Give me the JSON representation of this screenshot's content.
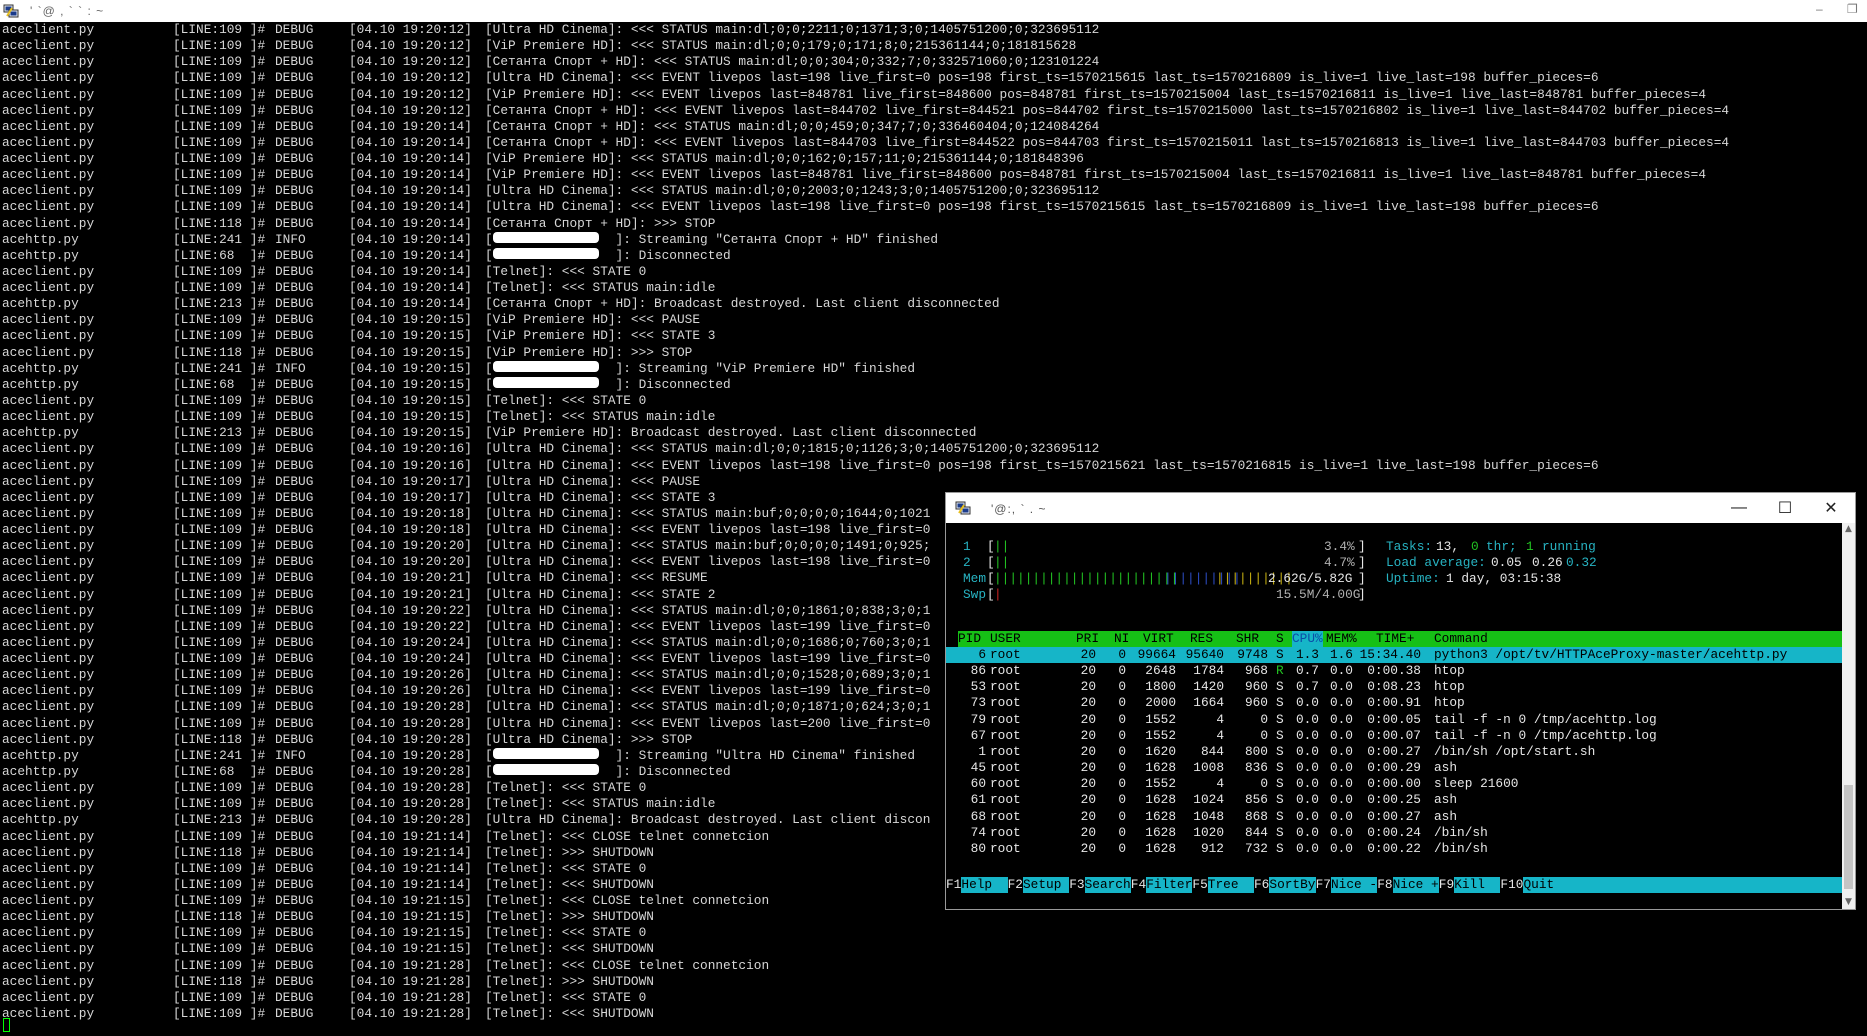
{
  "main_window": {
    "title": "' `@ , ` ` : ~",
    "controls": {
      "minimize": "–",
      "restore": "❐"
    }
  },
  "log_lines": [
    {
      "file": "aceclient.py",
      "line": "[LINE:109 ]#",
      "level": "DEBUG",
      "time": "[04.10 19:20:12]",
      "msg": "[Ultra HD Cinema]: <<< STATUS main:dl;0;0;2211;0;1371;3;0;1405751200;0;323695112"
    },
    {
      "file": "aceclient.py",
      "line": "[LINE:109 ]#",
      "level": "DEBUG",
      "time": "[04.10 19:20:12]",
      "msg": "[ViP Premiere HD]: <<< STATUS main:dl;0;0;179;0;171;8;0;215361144;0;181815628"
    },
    {
      "file": "aceclient.py",
      "line": "[LINE:109 ]#",
      "level": "DEBUG",
      "time": "[04.10 19:20:12]",
      "msg": "[Сетанта Спорт + HD]: <<< STATUS main:dl;0;0;304;0;332;7;0;332571060;0;123101224"
    },
    {
      "file": "aceclient.py",
      "line": "[LINE:109 ]#",
      "level": "DEBUG",
      "time": "[04.10 19:20:12]",
      "msg": "[Ultra HD Cinema]: <<< EVENT livepos last=198 live_first=0 pos=198 first_ts=1570215615 last_ts=1570216809 is_live=1 live_last=198 buffer_pieces=6"
    },
    {
      "file": "aceclient.py",
      "line": "[LINE:109 ]#",
      "level": "DEBUG",
      "time": "[04.10 19:20:12]",
      "msg": "[ViP Premiere HD]: <<< EVENT livepos last=848781 live_first=848600 pos=848781 first_ts=1570215004 last_ts=1570216811 is_live=1 live_last=848781 buffer_pieces=4"
    },
    {
      "file": "aceclient.py",
      "line": "[LINE:109 ]#",
      "level": "DEBUG",
      "time": "[04.10 19:20:12]",
      "msg": "[Сетанта Спорт + HD]: <<< EVENT livepos last=844702 live_first=844521 pos=844702 first_ts=1570215000 last_ts=1570216802 is_live=1 live_last=844702 buffer_pieces=4"
    },
    {
      "file": "aceclient.py",
      "line": "[LINE:109 ]#",
      "level": "DEBUG",
      "time": "[04.10 19:20:14]",
      "msg": "[Сетанта Спорт + HD]: <<< STATUS main:dl;0;0;459;0;347;7;0;336460404;0;124084264"
    },
    {
      "file": "aceclient.py",
      "line": "[LINE:109 ]#",
      "level": "DEBUG",
      "time": "[04.10 19:20:14]",
      "msg": "[Сетанта Спорт + HD]: <<< EVENT livepos last=844703 live_first=844522 pos=844703 first_ts=1570215011 last_ts=1570216813 is_live=1 live_last=844703 buffer_pieces=4"
    },
    {
      "file": "aceclient.py",
      "line": "[LINE:109 ]#",
      "level": "DEBUG",
      "time": "[04.10 19:20:14]",
      "msg": "[ViP Premiere HD]: <<< STATUS main:dl;0;0;162;0;157;11;0;215361144;0;181848396"
    },
    {
      "file": "aceclient.py",
      "line": "[LINE:109 ]#",
      "level": "DEBUG",
      "time": "[04.10 19:20:14]",
      "msg": "[ViP Premiere HD]: <<< EVENT livepos last=848781 live_first=848600 pos=848781 first_ts=1570215004 last_ts=1570216811 is_live=1 live_last=848781 buffer_pieces=4"
    },
    {
      "file": "aceclient.py",
      "line": "[LINE:109 ]#",
      "level": "DEBUG",
      "time": "[04.10 19:20:14]",
      "msg": "[Ultra HD Cinema]: <<< STATUS main:dl;0;0;2003;0;1243;3;0;1405751200;0;323695112"
    },
    {
      "file": "aceclient.py",
      "line": "[LINE:109 ]#",
      "level": "DEBUG",
      "time": "[04.10 19:20:14]",
      "msg": "[Ultra HD Cinema]: <<< EVENT livepos last=198 live_first=0 pos=198 first_ts=1570215615 last_ts=1570216809 is_live=1 live_last=198 buffer_pieces=6"
    },
    {
      "file": "aceclient.py",
      "line": "[LINE:118 ]#",
      "level": "DEBUG",
      "time": "[04.10 19:20:14]",
      "msg": "[Сетанта Спорт + HD]: >>> STOP"
    },
    {
      "file": "acehttp.py",
      "line": "[LINE:241 ]#",
      "level": "INFO",
      "time": "[04.10 19:20:14]",
      "msg": "[                ]: Streaming \"Сетанта Спорт + HD\" finished",
      "redact": true
    },
    {
      "file": "acehttp.py",
      "line": "[LINE:68  ]#",
      "level": "DEBUG",
      "time": "[04.10 19:20:14]",
      "msg": "[                ]: Disconnected",
      "redact": true
    },
    {
      "file": "aceclient.py",
      "line": "[LINE:109 ]#",
      "level": "DEBUG",
      "time": "[04.10 19:20:14]",
      "msg": "[Telnet]: <<< STATE 0"
    },
    {
      "file": "aceclient.py",
      "line": "[LINE:109 ]#",
      "level": "DEBUG",
      "time": "[04.10 19:20:14]",
      "msg": "[Telnet]: <<< STATUS main:idle"
    },
    {
      "file": "acehttp.py",
      "line": "[LINE:213 ]#",
      "level": "DEBUG",
      "time": "[04.10 19:20:14]",
      "msg": "[Сетанта Спорт + HD]: Broadcast destroyed. Last client disconnected"
    },
    {
      "file": "aceclient.py",
      "line": "[LINE:109 ]#",
      "level": "DEBUG",
      "time": "[04.10 19:20:15]",
      "msg": "[ViP Premiere HD]: <<< PAUSE"
    },
    {
      "file": "aceclient.py",
      "line": "[LINE:109 ]#",
      "level": "DEBUG",
      "time": "[04.10 19:20:15]",
      "msg": "[ViP Premiere HD]: <<< STATE 3"
    },
    {
      "file": "aceclient.py",
      "line": "[LINE:118 ]#",
      "level": "DEBUG",
      "time": "[04.10 19:20:15]",
      "msg": "[ViP Premiere HD]: >>> STOP"
    },
    {
      "file": "acehttp.py",
      "line": "[LINE:241 ]#",
      "level": "INFO",
      "time": "[04.10 19:20:15]",
      "msg": "[                ]: Streaming \"ViP Premiere HD\" finished",
      "redact": true
    },
    {
      "file": "acehttp.py",
      "line": "[LINE:68  ]#",
      "level": "DEBUG",
      "time": "[04.10 19:20:15]",
      "msg": "[                ]: Disconnected",
      "redact": true
    },
    {
      "file": "aceclient.py",
      "line": "[LINE:109 ]#",
      "level": "DEBUG",
      "time": "[04.10 19:20:15]",
      "msg": "[Telnet]: <<< STATE 0"
    },
    {
      "file": "aceclient.py",
      "line": "[LINE:109 ]#",
      "level": "DEBUG",
      "time": "[04.10 19:20:15]",
      "msg": "[Telnet]: <<< STATUS main:idle"
    },
    {
      "file": "acehttp.py",
      "line": "[LINE:213 ]#",
      "level": "DEBUG",
      "time": "[04.10 19:20:15]",
      "msg": "[ViP Premiere HD]: Broadcast destroyed. Last client disconnected"
    },
    {
      "file": "aceclient.py",
      "line": "[LINE:109 ]#",
      "level": "DEBUG",
      "time": "[04.10 19:20:16]",
      "msg": "[Ultra HD Cinema]: <<< STATUS main:dl;0;0;1815;0;1126;3;0;1405751200;0;323695112"
    },
    {
      "file": "aceclient.py",
      "line": "[LINE:109 ]#",
      "level": "DEBUG",
      "time": "[04.10 19:20:16]",
      "msg": "[Ultra HD Cinema]: <<< EVENT livepos last=198 live_first=0 pos=198 first_ts=1570215621 last_ts=1570216815 is_live=1 live_last=198 buffer_pieces=6"
    },
    {
      "file": "aceclient.py",
      "line": "[LINE:109 ]#",
      "level": "DEBUG",
      "time": "[04.10 19:20:17]",
      "msg": "[Ultra HD Cinema]: <<< PAUSE"
    },
    {
      "file": "aceclient.py",
      "line": "[LINE:109 ]#",
      "level": "DEBUG",
      "time": "[04.10 19:20:17]",
      "msg": "[Ultra HD Cinema]: <<< STATE 3"
    },
    {
      "file": "aceclient.py",
      "line": "[LINE:109 ]#",
      "level": "DEBUG",
      "time": "[04.10 19:20:18]",
      "msg": "[Ultra HD Cinema]: <<< STATUS main:buf;0;0;0;0;1644;0;1021"
    },
    {
      "file": "aceclient.py",
      "line": "[LINE:109 ]#",
      "level": "DEBUG",
      "time": "[04.10 19:20:18]",
      "msg": "[Ultra HD Cinema]: <<< EVENT livepos last=198 live_first=0"
    },
    {
      "file": "aceclient.py",
      "line": "[LINE:109 ]#",
      "level": "DEBUG",
      "time": "[04.10 19:20:20]",
      "msg": "[Ultra HD Cinema]: <<< STATUS main:buf;0;0;0;0;1491;0;925;"
    },
    {
      "file": "aceclient.py",
      "line": "[LINE:109 ]#",
      "level": "DEBUG",
      "time": "[04.10 19:20:20]",
      "msg": "[Ultra HD Cinema]: <<< EVENT livepos last=198 live_first=0"
    },
    {
      "file": "aceclient.py",
      "line": "[LINE:109 ]#",
      "level": "DEBUG",
      "time": "[04.10 19:20:21]",
      "msg": "[Ultra HD Cinema]: <<< RESUME"
    },
    {
      "file": "aceclient.py",
      "line": "[LINE:109 ]#",
      "level": "DEBUG",
      "time": "[04.10 19:20:21]",
      "msg": "[Ultra HD Cinema]: <<< STATE 2"
    },
    {
      "file": "aceclient.py",
      "line": "[LINE:109 ]#",
      "level": "DEBUG",
      "time": "[04.10 19:20:22]",
      "msg": "[Ultra HD Cinema]: <<< STATUS main:dl;0;0;1861;0;838;3;0;1"
    },
    {
      "file": "aceclient.py",
      "line": "[LINE:109 ]#",
      "level": "DEBUG",
      "time": "[04.10 19:20:22]",
      "msg": "[Ultra HD Cinema]: <<< EVENT livepos last=199 live_first=0"
    },
    {
      "file": "aceclient.py",
      "line": "[LINE:109 ]#",
      "level": "DEBUG",
      "time": "[04.10 19:20:24]",
      "msg": "[Ultra HD Cinema]: <<< STATUS main:dl;0;0;1686;0;760;3;0;1"
    },
    {
      "file": "aceclient.py",
      "line": "[LINE:109 ]#",
      "level": "DEBUG",
      "time": "[04.10 19:20:24]",
      "msg": "[Ultra HD Cinema]: <<< EVENT livepos last=199 live_first=0"
    },
    {
      "file": "aceclient.py",
      "line": "[LINE:109 ]#",
      "level": "DEBUG",
      "time": "[04.10 19:20:26]",
      "msg": "[Ultra HD Cinema]: <<< STATUS main:dl;0;0;1528;0;689;3;0;1"
    },
    {
      "file": "aceclient.py",
      "line": "[LINE:109 ]#",
      "level": "DEBUG",
      "time": "[04.10 19:20:26]",
      "msg": "[Ultra HD Cinema]: <<< EVENT livepos last=199 live_first=0"
    },
    {
      "file": "aceclient.py",
      "line": "[LINE:109 ]#",
      "level": "DEBUG",
      "time": "[04.10 19:20:28]",
      "msg": "[Ultra HD Cinema]: <<< STATUS main:dl;0;0;1871;0;624;3;0;1"
    },
    {
      "file": "aceclient.py",
      "line": "[LINE:109 ]#",
      "level": "DEBUG",
      "time": "[04.10 19:20:28]",
      "msg": "[Ultra HD Cinema]: <<< EVENT livepos last=200 live_first=0"
    },
    {
      "file": "aceclient.py",
      "line": "[LINE:118 ]#",
      "level": "DEBUG",
      "time": "[04.10 19:20:28]",
      "msg": "[Ultra HD Cinema]: >>> STOP"
    },
    {
      "file": "acehttp.py",
      "line": "[LINE:241 ]#",
      "level": "INFO",
      "time": "[04.10 19:20:28]",
      "msg": "[                ]: Streaming \"Ultra HD Cinema\" finished",
      "redact": true
    },
    {
      "file": "acehttp.py",
      "line": "[LINE:68  ]#",
      "level": "DEBUG",
      "time": "[04.10 19:20:28]",
      "msg": "[                ]: Disconnected",
      "redact": true
    },
    {
      "file": "aceclient.py",
      "line": "[LINE:109 ]#",
      "level": "DEBUG",
      "time": "[04.10 19:20:28]",
      "msg": "[Telnet]: <<< STATE 0"
    },
    {
      "file": "aceclient.py",
      "line": "[LINE:109 ]#",
      "level": "DEBUG",
      "time": "[04.10 19:20:28]",
      "msg": "[Telnet]: <<< STATUS main:idle"
    },
    {
      "file": "acehttp.py",
      "line": "[LINE:213 ]#",
      "level": "DEBUG",
      "time": "[04.10 19:20:28]",
      "msg": "[Ultra HD Cinema]: Broadcast destroyed. Last client discon"
    },
    {
      "file": "aceclient.py",
      "line": "[LINE:109 ]#",
      "level": "DEBUG",
      "time": "[04.10 19:21:14]",
      "msg": "[Telnet]: <<< CLOSE telnet connetcion"
    },
    {
      "file": "aceclient.py",
      "line": "[LINE:118 ]#",
      "level": "DEBUG",
      "time": "[04.10 19:21:14]",
      "msg": "[Telnet]: >>> SHUTDOWN"
    },
    {
      "file": "aceclient.py",
      "line": "[LINE:109 ]#",
      "level": "DEBUG",
      "time": "[04.10 19:21:14]",
      "msg": "[Telnet]: <<< STATE 0"
    },
    {
      "file": "aceclient.py",
      "line": "[LINE:109 ]#",
      "level": "DEBUG",
      "time": "[04.10 19:21:14]",
      "msg": "[Telnet]: <<< SHUTDOWN"
    },
    {
      "file": "aceclient.py",
      "line": "[LINE:109 ]#",
      "level": "DEBUG",
      "time": "[04.10 19:21:15]",
      "msg": "[Telnet]: <<< CLOSE telnet connetcion"
    },
    {
      "file": "aceclient.py",
      "line": "[LINE:118 ]#",
      "level": "DEBUG",
      "time": "[04.10 19:21:15]",
      "msg": "[Telnet]: >>> SHUTDOWN"
    },
    {
      "file": "aceclient.py",
      "line": "[LINE:109 ]#",
      "level": "DEBUG",
      "time": "[04.10 19:21:15]",
      "msg": "[Telnet]: <<< STATE 0"
    },
    {
      "file": "aceclient.py",
      "line": "[LINE:109 ]#",
      "level": "DEBUG",
      "time": "[04.10 19:21:15]",
      "msg": "[Telnet]: <<< SHUTDOWN"
    },
    {
      "file": "aceclient.py",
      "line": "[LINE:109 ]#",
      "level": "DEBUG",
      "time": "[04.10 19:21:28]",
      "msg": "[Telnet]: <<< CLOSE telnet connetcion"
    },
    {
      "file": "aceclient.py",
      "line": "[LINE:118 ]#",
      "level": "DEBUG",
      "time": "[04.10 19:21:28]",
      "msg": "[Telnet]: >>> SHUTDOWN"
    },
    {
      "file": "aceclient.py",
      "line": "[LINE:109 ]#",
      "level": "DEBUG",
      "time": "[04.10 19:21:28]",
      "msg": "[Telnet]: <<< STATE 0"
    },
    {
      "file": "aceclient.py",
      "line": "[LINE:109 ]#",
      "level": "DEBUG",
      "time": "[04.10 19:21:28]",
      "msg": "[Telnet]: <<< SHUTDOWN"
    }
  ],
  "htop_window": {
    "title": "'@:, ` . ~",
    "controls": {
      "minimize": "—",
      "maximize": "☐",
      "close": "✕"
    },
    "meters": {
      "cpu1": {
        "label": "1",
        "bar": "||",
        "value": "3.4%"
      },
      "cpu2": {
        "label": "2",
        "bar": "||",
        "value": "4.7%"
      },
      "mem": {
        "label": "Mem",
        "bar_green": "||||||||||||||||||||||||",
        "bar_blue": "||||||||||",
        "bar_yellow": "||||||||||",
        "value": "2.62G/5.82G"
      },
      "swp": {
        "label": "Swp",
        "bar_red": "|",
        "value": "15.5M/4.00G"
      },
      "tasks_label": "Tasks:",
      "tasks": "13,",
      "thr": "0",
      "thr_label": "thr;",
      "running": "1",
      "running_label": "running",
      "load_label": "Load average:",
      "load1": "0.05",
      "load5": "0.26",
      "load15": "0.32",
      "uptime_label": "Uptime:",
      "uptime": "1 day, 03:15:38"
    },
    "columns": [
      "PID",
      "USER",
      "PRI",
      "NI",
      "VIRT",
      "RES",
      "SHR",
      "S",
      "CPU%",
      "MEM%",
      "TIME+",
      "Command"
    ],
    "processes": [
      {
        "pid": "6",
        "user": "root",
        "pri": "20",
        "ni": "0",
        "virt": "99664",
        "res": "95640",
        "shr": "9748",
        "s": "S",
        "cpu": "1.3",
        "mem": "1.6",
        "time": "15:34.40",
        "cmd": "python3 /opt/tv/HTTPAceProxy-master/acehttp.py"
      },
      {
        "pid": "86",
        "user": "root",
        "pri": "20",
        "ni": "0",
        "virt": "2648",
        "res": "1784",
        "shr": "968",
        "s": "R",
        "cpu": "0.7",
        "mem": "0.0",
        "time": "0:00.38",
        "cmd": "htop"
      },
      {
        "pid": "53",
        "user": "root",
        "pri": "20",
        "ni": "0",
        "virt": "1800",
        "res": "1420",
        "shr": "960",
        "s": "S",
        "cpu": "0.7",
        "mem": "0.0",
        "time": "0:08.23",
        "cmd": "htop"
      },
      {
        "pid": "73",
        "user": "root",
        "pri": "20",
        "ni": "0",
        "virt": "2000",
        "res": "1664",
        "shr": "960",
        "s": "S",
        "cpu": "0.0",
        "mem": "0.0",
        "time": "0:00.91",
        "cmd": "htop"
      },
      {
        "pid": "79",
        "user": "root",
        "pri": "20",
        "ni": "0",
        "virt": "1552",
        "res": "4",
        "shr": "0",
        "s": "S",
        "cpu": "0.0",
        "mem": "0.0",
        "time": "0:00.05",
        "cmd": "tail -f -n 0 /tmp/acehttp.log"
      },
      {
        "pid": "67",
        "user": "root",
        "pri": "20",
        "ni": "0",
        "virt": "1552",
        "res": "4",
        "shr": "0",
        "s": "S",
        "cpu": "0.0",
        "mem": "0.0",
        "time": "0:00.07",
        "cmd": "tail -f -n 0 /tmp/acehttp.log"
      },
      {
        "pid": "1",
        "user": "root",
        "pri": "20",
        "ni": "0",
        "virt": "1620",
        "res": "844",
        "shr": "800",
        "s": "S",
        "cpu": "0.0",
        "mem": "0.0",
        "time": "0:00.27",
        "cmd": "/bin/sh /opt/start.sh"
      },
      {
        "pid": "45",
        "user": "root",
        "pri": "20",
        "ni": "0",
        "virt": "1628",
        "res": "1008",
        "shr": "836",
        "s": "S",
        "cpu": "0.0",
        "mem": "0.0",
        "time": "0:00.29",
        "cmd": "ash"
      },
      {
        "pid": "60",
        "user": "root",
        "pri": "20",
        "ni": "0",
        "virt": "1552",
        "res": "4",
        "shr": "0",
        "s": "S",
        "cpu": "0.0",
        "mem": "0.0",
        "time": "0:00.00",
        "cmd": "sleep 21600"
      },
      {
        "pid": "61",
        "user": "root",
        "pri": "20",
        "ni": "0",
        "virt": "1628",
        "res": "1024",
        "shr": "856",
        "s": "S",
        "cpu": "0.0",
        "mem": "0.0",
        "time": "0:00.25",
        "cmd": "ash"
      },
      {
        "pid": "68",
        "user": "root",
        "pri": "20",
        "ni": "0",
        "virt": "1628",
        "res": "1048",
        "shr": "868",
        "s": "S",
        "cpu": "0.0",
        "mem": "0.0",
        "time": "0:00.27",
        "cmd": "ash"
      },
      {
        "pid": "74",
        "user": "root",
        "pri": "20",
        "ni": "0",
        "virt": "1628",
        "res": "1020",
        "shr": "844",
        "s": "S",
        "cpu": "0.0",
        "mem": "0.0",
        "time": "0:00.24",
        "cmd": "/bin/sh"
      },
      {
        "pid": "80",
        "user": "root",
        "pri": "20",
        "ni": "0",
        "virt": "1628",
        "res": "912",
        "shr": "732",
        "s": "S",
        "cpu": "0.0",
        "mem": "0.0",
        "time": "0:00.22",
        "cmd": "/bin/sh"
      }
    ],
    "fkeys": [
      {
        "num": "F1",
        "label": "Help  "
      },
      {
        "num": "F2",
        "label": "Setup "
      },
      {
        "num": "F3",
        "label": "Search"
      },
      {
        "num": "F4",
        "label": "Filter"
      },
      {
        "num": "F5",
        "label": "Tree  "
      },
      {
        "num": "F6",
        "label": "SortBy"
      },
      {
        "num": "F7",
        "label": "Nice -"
      },
      {
        "num": "F8",
        "label": "Nice +"
      },
      {
        "num": "F9",
        "label": "Kill  "
      },
      {
        "num": "F10",
        "label": "Quit"
      }
    ],
    "scroll": {
      "up": "▲",
      "down": "▼"
    }
  }
}
